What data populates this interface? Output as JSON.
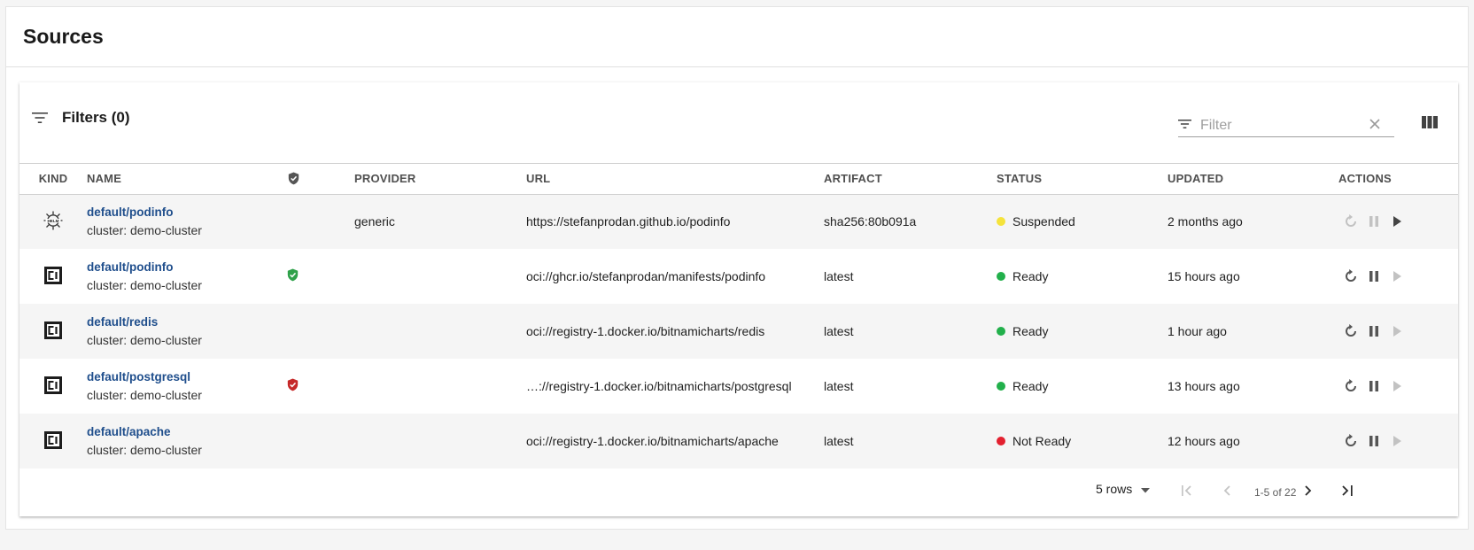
{
  "page": {
    "title": "Sources"
  },
  "toolbar": {
    "filters_label": "Filters (0)",
    "filter_placeholder": "Filter"
  },
  "columns": [
    "Kind",
    "Name",
    "",
    "Provider",
    "URL",
    "Artifact",
    "Status",
    "Updated",
    "Actions"
  ],
  "rows": [
    {
      "kind_icon": "helm-icon",
      "name": "default/podinfo",
      "cluster": "cluster: demo-cluster",
      "verified": "",
      "provider": "generic",
      "url": "https://stefanprodan.github.io/podinfo",
      "artifact": "sha256:80b091a",
      "status": "Suspended",
      "status_color": "#f5e33b",
      "updated": "2 months ago",
      "suspended": true
    },
    {
      "kind_icon": "oci-icon",
      "name": "default/podinfo",
      "cluster": "cluster: demo-cluster",
      "verified": "verified",
      "provider": "",
      "url": "oci://ghcr.io/stefanprodan/manifests/podinfo",
      "artifact": "latest",
      "status": "Ready",
      "status_color": "#22b04b",
      "updated": "15 hours ago",
      "suspended": false
    },
    {
      "kind_icon": "oci-icon",
      "name": "default/redis",
      "cluster": "cluster: demo-cluster",
      "verified": "",
      "provider": "",
      "url": "oci://registry-1.docker.io/bitnamicharts/redis",
      "artifact": "latest",
      "status": "Ready",
      "status_color": "#22b04b",
      "updated": "1 hour ago",
      "suspended": false
    },
    {
      "kind_icon": "oci-icon",
      "name": "default/postgresql",
      "cluster": "cluster: demo-cluster",
      "verified": "failed",
      "provider": "",
      "url": "…://registry-1.docker.io/bitnamicharts/postgresql",
      "artifact": "latest",
      "status": "Ready",
      "status_color": "#22b04b",
      "updated": "13 hours ago",
      "suspended": false
    },
    {
      "kind_icon": "oci-icon",
      "name": "default/apache",
      "cluster": "cluster: demo-cluster",
      "verified": "",
      "provider": "",
      "url": "oci://registry-1.docker.io/bitnamicharts/apache",
      "artifact": "latest",
      "status": "Not Ready",
      "status_color": "#e3202f",
      "updated": "12 hours ago",
      "suspended": false
    }
  ],
  "pagination": {
    "rows_label": "5 rows",
    "range": "1-5 of 22"
  },
  "colors": {
    "link": "#1f4e8c",
    "verified_ok": "#2fa14a",
    "verified_fail": "#c62828"
  }
}
